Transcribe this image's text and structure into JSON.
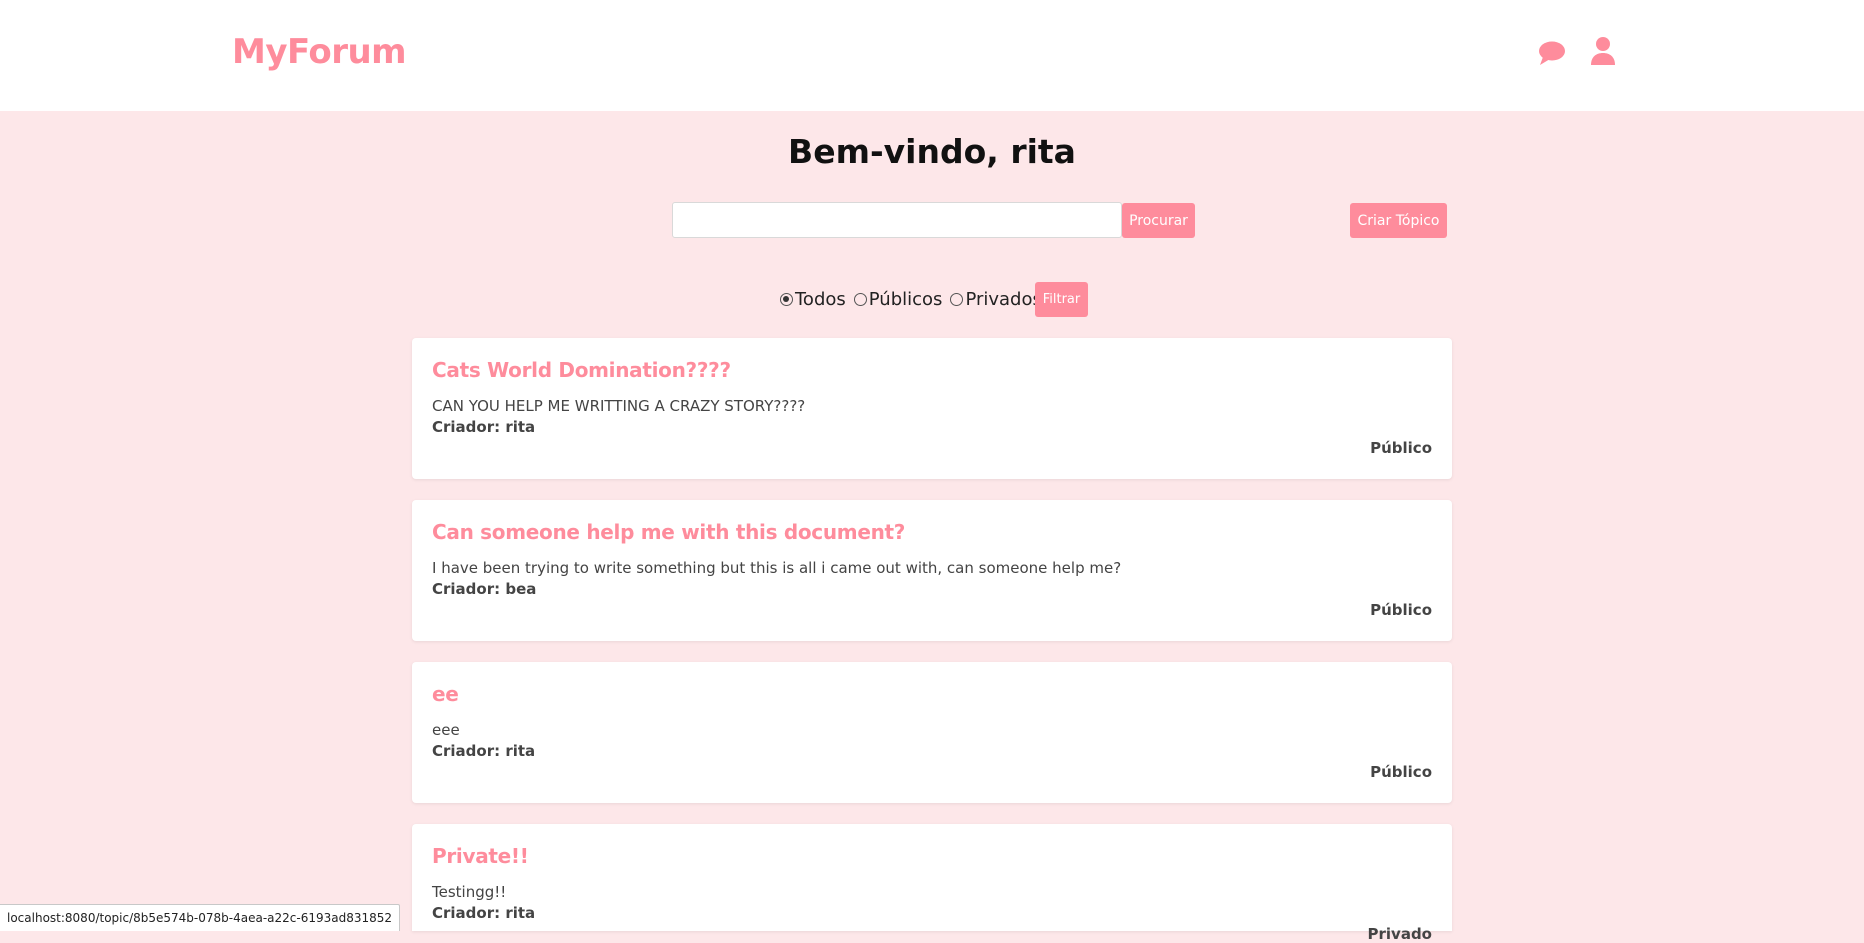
{
  "header": {
    "brand": "MyForum",
    "icons": [
      "chat-icon",
      "user-icon"
    ],
    "accent_color": "#fe8c9c"
  },
  "welcome": {
    "prefix": "Bem-vindo, ",
    "username": "rita"
  },
  "search": {
    "placeholder": "",
    "value": "",
    "button_label": "Procurar"
  },
  "create_button_label": "Criar Tópico",
  "filters": {
    "options": [
      {
        "label": "Todos",
        "checked": true
      },
      {
        "label": "Públicos",
        "checked": false
      },
      {
        "label": "Privados",
        "checked": false
      }
    ],
    "button_label": "Filtrar"
  },
  "topics": [
    {
      "title": "Cats World Domination????",
      "body": "CAN YOU HELP ME WRITTING A CRAZY STORY????",
      "creator": "Criador: rita",
      "visibility": "Público"
    },
    {
      "title": "Can someone help me with this document?",
      "body": "I have been trying to write something but this is all i came out with, can someone help me?",
      "creator": "Criador: bea",
      "visibility": "Público"
    },
    {
      "title": "ee",
      "body": "eee",
      "creator": "Criador: rita",
      "visibility": "Público"
    },
    {
      "title": "Private!!",
      "body": "Testingg!!",
      "creator": "Criador: rita",
      "visibility": "Privado"
    }
  ],
  "status_url": "localhost:8080/topic/8b5e574b-078b-4aea-a22c-6193ad831852",
  "colors": {
    "page_background": "#fde7e9",
    "card_background": "#ffffff",
    "accent": "#fe8c9c"
  }
}
